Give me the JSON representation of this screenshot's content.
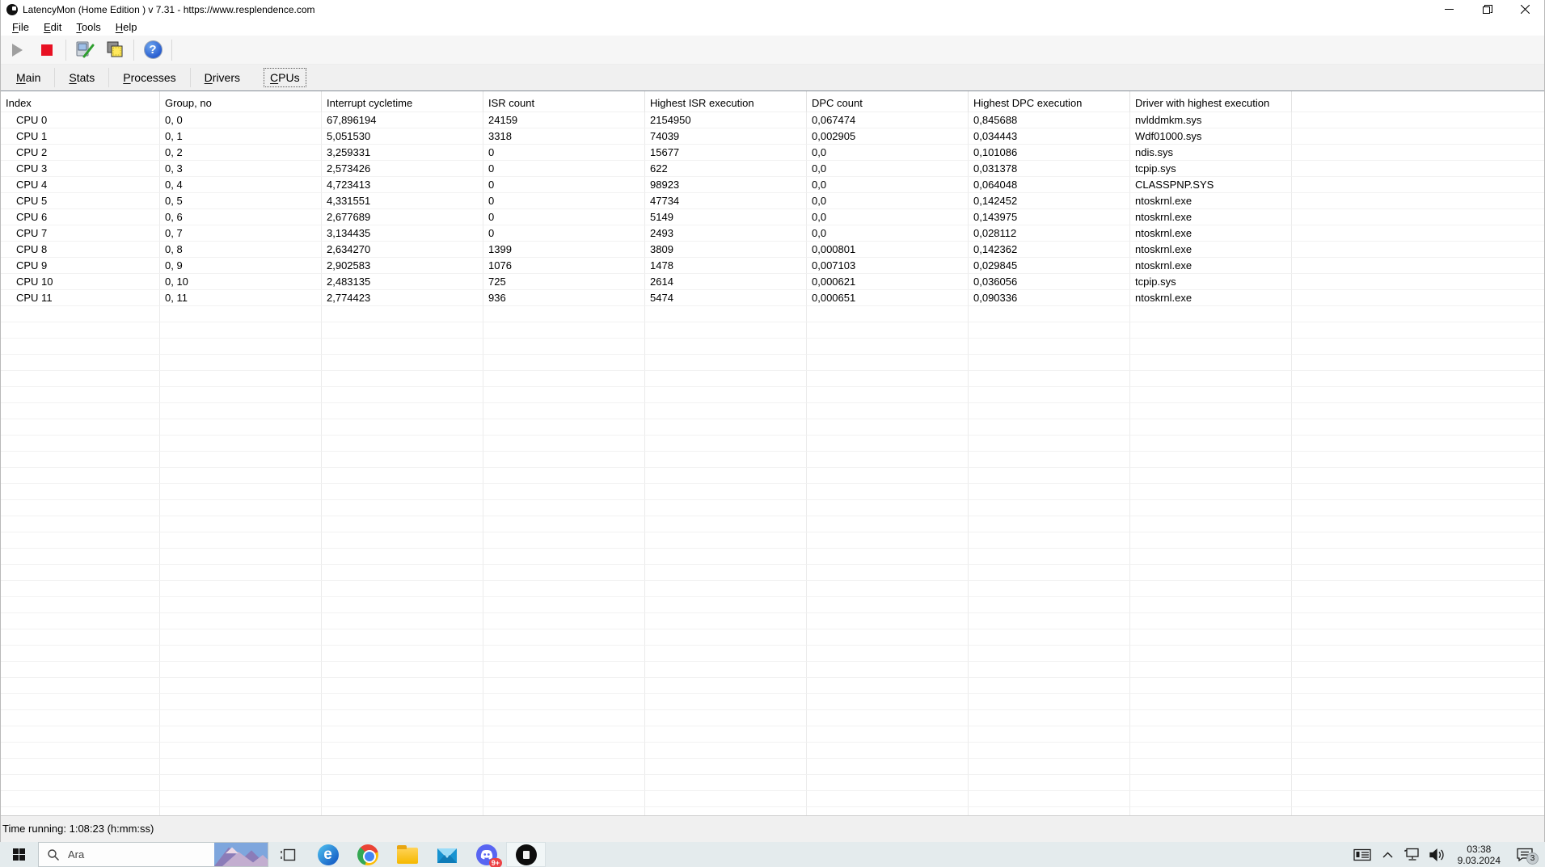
{
  "app": {
    "title": "LatencyMon  (Home Edition )  v 7.31 - https://www.resplendence.com",
    "menu": [
      {
        "label": "File"
      },
      {
        "label": "Edit"
      },
      {
        "label": "Tools"
      },
      {
        "label": "Help"
      }
    ],
    "toolbar": {
      "play_icon": "play",
      "stop_icon": "stop",
      "monitor_tool_icon": "monitor-report",
      "windows_copy_icon": "stack-windows",
      "help_glyph": "?"
    },
    "tabs": [
      {
        "label": "Main",
        "active": false
      },
      {
        "label": "Stats",
        "active": false
      },
      {
        "label": "Processes",
        "active": false
      },
      {
        "label": "Drivers",
        "active": false
      },
      {
        "label": "CPUs",
        "active": true
      }
    ],
    "status_bar": "Time running: 1:08:23  (h:mm:ss)"
  },
  "cpu_table": {
    "columns": [
      "Index",
      "Group, no",
      "Interrupt cycletime",
      "ISR count",
      "Highest ISR execution",
      "DPC count",
      "Highest DPC execution",
      "Driver with highest execution"
    ],
    "rows": [
      [
        "CPU 0",
        "0, 0",
        "67,896194",
        "24159",
        "2154950",
        "0,067474",
        "0,845688",
        "nvlddmkm.sys"
      ],
      [
        "CPU 1",
        "0, 1",
        "5,051530",
        "3318",
        "74039",
        "0,002905",
        "0,034443",
        "Wdf01000.sys"
      ],
      [
        "CPU 2",
        "0, 2",
        "3,259331",
        "0",
        "15677",
        "0,0",
        "0,101086",
        "ndis.sys"
      ],
      [
        "CPU 3",
        "0, 3",
        "2,573426",
        "0",
        "622",
        "0,0",
        "0,031378",
        "tcpip.sys"
      ],
      [
        "CPU 4",
        "0, 4",
        "4,723413",
        "0",
        "98923",
        "0,0",
        "0,064048",
        "CLASSPNP.SYS"
      ],
      [
        "CPU 5",
        "0, 5",
        "4,331551",
        "0",
        "47734",
        "0,0",
        "0,142452",
        "ntoskrnl.exe"
      ],
      [
        "CPU 6",
        "0, 6",
        "2,677689",
        "0",
        "5149",
        "0,0",
        "0,143975",
        "ntoskrnl.exe"
      ],
      [
        "CPU 7",
        "0, 7",
        "3,134435",
        "0",
        "2493",
        "0,0",
        "0,028112",
        "ntoskrnl.exe"
      ],
      [
        "CPU 8",
        "0, 8",
        "2,634270",
        "1399",
        "3809",
        "0,000801",
        "0,142362",
        "ntoskrnl.exe"
      ],
      [
        "CPU 9",
        "0, 9",
        "2,902583",
        "1076",
        "1478",
        "0,007103",
        "0,029845",
        "ntoskrnl.exe"
      ],
      [
        "CPU 10",
        "0, 10",
        "2,483135",
        "725",
        "2614",
        "0,000621",
        "0,036056",
        "tcpip.sys"
      ],
      [
        "CPU 11",
        "0, 11",
        "2,774423",
        "936",
        "5474",
        "0,000651",
        "0,090336",
        "ntoskrnl.exe"
      ]
    ]
  },
  "taskbar": {
    "search": {
      "placeholder": "Ara"
    },
    "discord_badge": "9+",
    "tray": {
      "time": "03:38",
      "date": "9.03.2024",
      "notification_count": "3"
    }
  },
  "edge_glyph": "e",
  "colors": {
    "stop_red": "#e81123",
    "help_blue": "#2a5fd0",
    "discord_blurple": "#5865f2",
    "badge_red": "#ec4245",
    "chrome_blue": "#4285f4",
    "folder_yellow": "#f5b800"
  }
}
